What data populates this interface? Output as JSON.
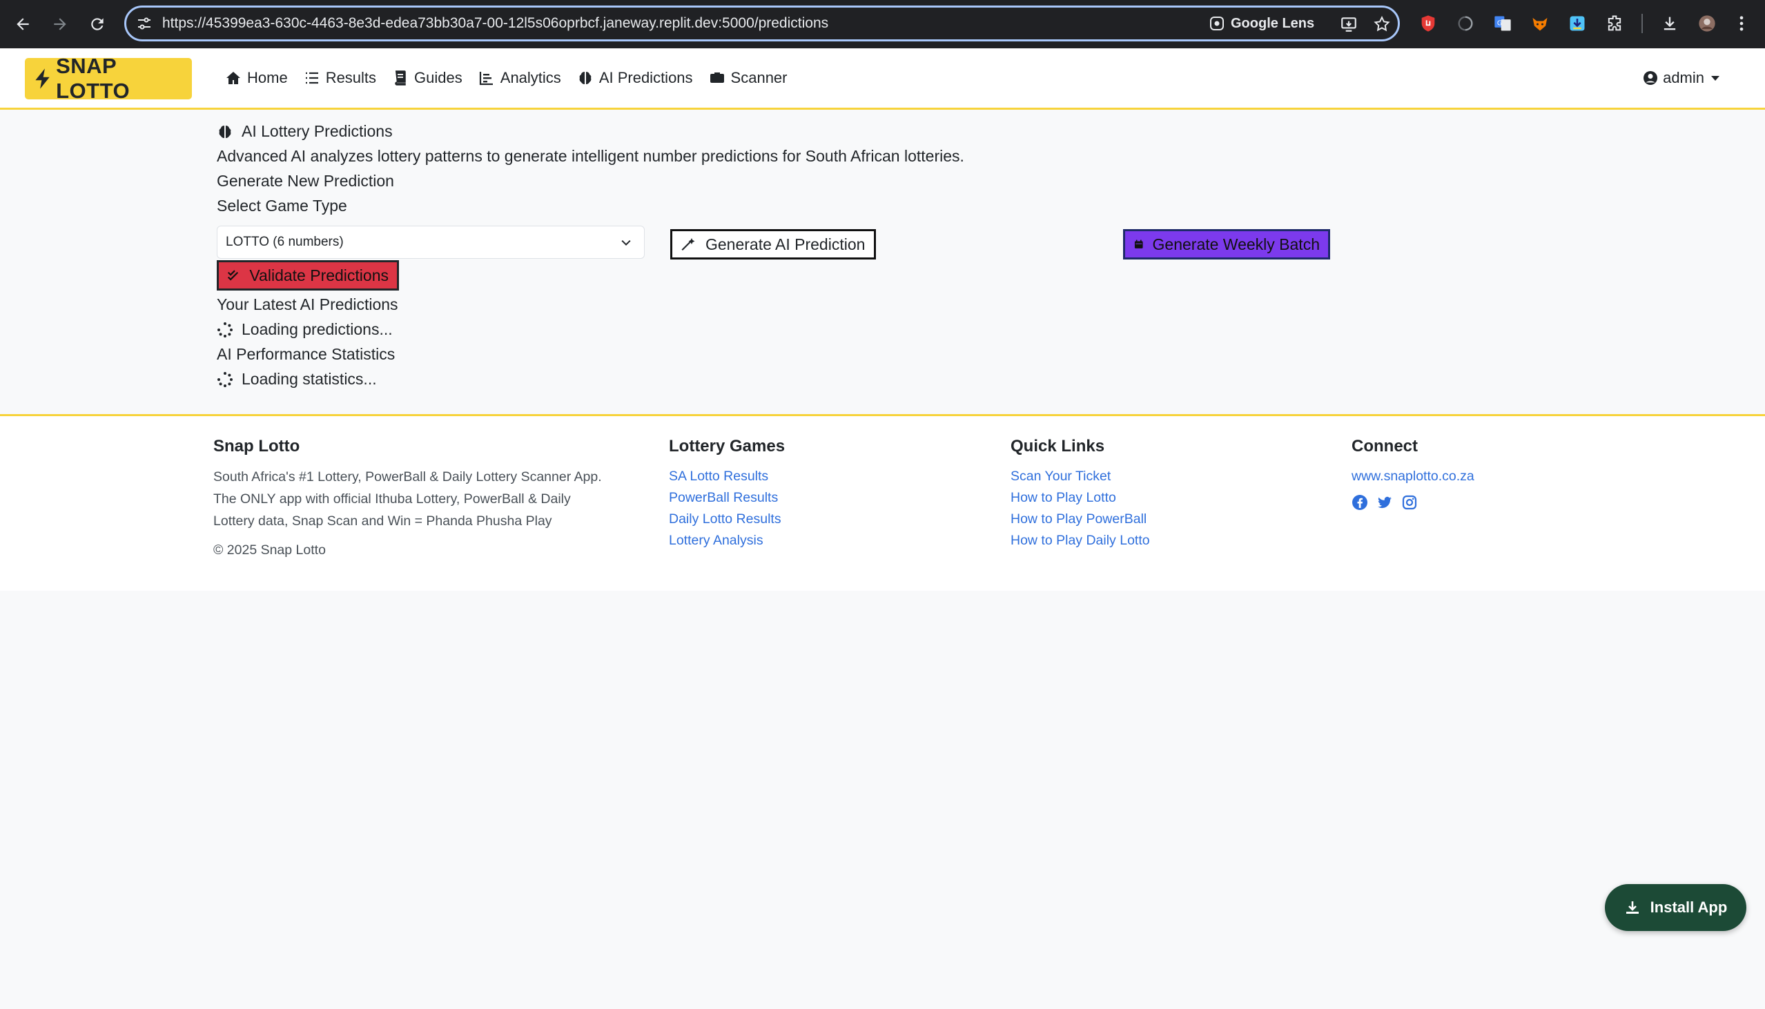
{
  "browser": {
    "url": "https://45399ea3-630c-4463-8e3d-edea73bb30a7-00-12l5s06oprbcf.janeway.replit.dev:5000/predictions",
    "lens_label": "Google Lens"
  },
  "navbar": {
    "brand": "SNAP LOTTO",
    "links": [
      {
        "label": "Home",
        "icon": "home-icon"
      },
      {
        "label": "Results",
        "icon": "list-icon"
      },
      {
        "label": "Guides",
        "icon": "book-icon"
      },
      {
        "label": "Analytics",
        "icon": "chart-icon"
      },
      {
        "label": "AI Predictions",
        "icon": "brain-icon"
      },
      {
        "label": "Scanner",
        "icon": "camera-icon"
      }
    ],
    "user": "admin"
  },
  "main": {
    "title": "AI Lottery Predictions",
    "description": "Advanced AI analyzes lottery patterns to generate intelligent number predictions for South African lotteries.",
    "generate_heading": "Generate New Prediction",
    "select_label": "Select Game Type",
    "select_value": "LOTTO (6 numbers)",
    "generate_button": "Generate AI Prediction",
    "weekly_button": "Generate Weekly Batch",
    "validate_button": "Validate Predictions",
    "latest_heading": "Your Latest AI Predictions",
    "loading_predictions": "Loading predictions...",
    "stats_heading": "AI Performance Statistics",
    "loading_stats": "Loading statistics..."
  },
  "footer": {
    "about": {
      "title": "Snap Lotto",
      "line1": "South Africa's #1 Lottery, PowerBall & Daily Lottery Scanner App.",
      "line2": "The ONLY app with official Ithuba Lottery, PowerBall & Daily",
      "line3": "Lottery data, Snap Scan and Win = Phanda Phusha Play",
      "copyright": "© 2025 Snap Lotto"
    },
    "games": {
      "title": "Lottery Games",
      "links": [
        "SA Lotto Results",
        "PowerBall Results",
        "Daily Lotto Results",
        "Lottery Analysis"
      ]
    },
    "quick": {
      "title": "Quick Links",
      "links": [
        "Scan Your Ticket",
        "How to Play Lotto",
        "How to Play PowerBall",
        "How to Play Daily Lotto"
      ]
    },
    "connect": {
      "title": "Connect",
      "website": "www.snaplotto.co.za"
    }
  },
  "install_button": "Install App",
  "colors": {
    "brand_yellow": "#f7d33b",
    "weekly_purple": "#7c3aed",
    "validate_red": "#dc3545",
    "link_blue": "#2f6fdc",
    "install_green": "#1c4a36"
  }
}
